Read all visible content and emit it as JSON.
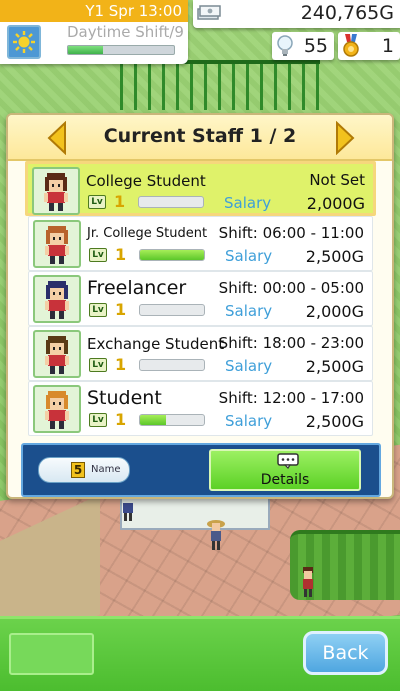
{
  "hud": {
    "date": "Y1 Spr 13:00",
    "shift": "Daytime Shift/9",
    "shift_progress": 0.33,
    "money": "240,765G",
    "research": "55",
    "medals": "1"
  },
  "panel": {
    "title": "Current Staff 1 / 2",
    "salary_label": "Salary",
    "staff": [
      {
        "name": "College Student",
        "shift": "Not Set",
        "salary": "2,000G",
        "level": "1",
        "xp": 0.0,
        "hair": "#5a2a16",
        "shirt": "#c8323a",
        "selected": true
      },
      {
        "name": "Jr. College Student",
        "shift": "Shift: 06:00 - 11:00",
        "salary": "2,500G",
        "level": "1",
        "xp": 1.0,
        "hair": "#b8632c",
        "shirt": "#c8323a",
        "selected": false
      },
      {
        "name": "Freelancer",
        "shift": "Shift: 00:00 - 05:00",
        "salary": "2,000G",
        "level": "1",
        "xp": 0.0,
        "hair": "#2a2f6a",
        "shirt": "#c8323a",
        "selected": false
      },
      {
        "name": "Exchange Student",
        "shift": "Shift: 18:00 - 23:00",
        "salary": "2,500G",
        "level": "1",
        "xp": 0.0,
        "hair": "#5a3a16",
        "shirt": "#c8323a",
        "selected": false
      },
      {
        "name": "Student",
        "shift": "Shift: 12:00 - 17:00",
        "salary": "2,500G",
        "level": "1",
        "xp": 0.4,
        "hair": "#d88a2c",
        "shirt": "#c8323a",
        "selected": false
      }
    ],
    "sort_number": "5",
    "sort_label": "Name",
    "details_label": "Details"
  },
  "bottom": {
    "back_label": "Back"
  },
  "colors": {
    "header_bg": "#fde89a",
    "selected_row": "#dff26a",
    "salary_blue": "#3f9fd9",
    "details_green": "#5cd126",
    "back_blue": "#4fa6e0"
  }
}
